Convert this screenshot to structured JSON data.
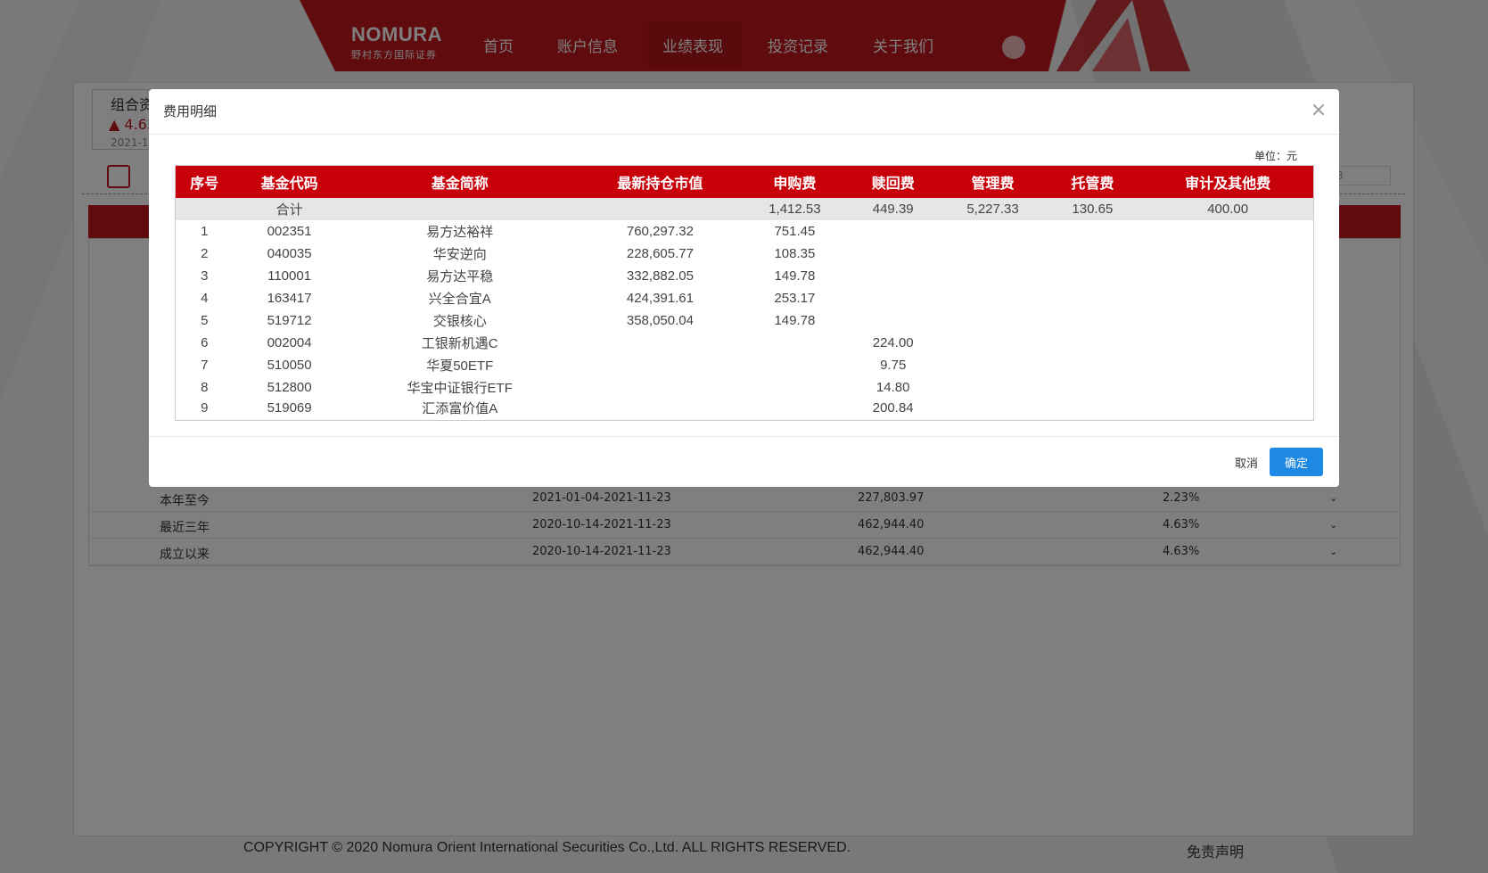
{
  "header": {
    "logo_main": "NOMURA",
    "logo_sub": "野村东方国际证券",
    "nav": [
      "首页",
      "账户信息",
      "业绩表现",
      "投资记录",
      "关于我们"
    ],
    "active_nav": "业绩表现"
  },
  "summary": {
    "title": "组合资",
    "value": "▲ 4.63",
    "date": "2021-1"
  },
  "bg_table_rows": [
    {
      "period": "本年至今",
      "range": "2021-01-04-2021-11-23",
      "amount": "227,803.97",
      "pct": "2.23%"
    },
    {
      "period": "最近三年",
      "range": "2020-10-14-2021-11-23",
      "amount": "462,944.40",
      "pct": "4.63%"
    },
    {
      "period": "成立以来",
      "range": "2020-10-14-2021-11-23",
      "amount": "462,944.40",
      "pct": "4.63%"
    }
  ],
  "footer": {
    "copyright": "COPYRIGHT © 2020 Nomura Orient International Securities Co.,Ltd. ALL RIGHTS RESERVED.",
    "disclaimer": "免责声明"
  },
  "modal": {
    "title": "费用明细",
    "close": "×",
    "unit": "单位：元",
    "columns": [
      "序号",
      "基金代码",
      "基金简称",
      "最新持仓市值",
      "申购费",
      "赎回费",
      "管理费",
      "托管费",
      "审计及其他费"
    ],
    "total": {
      "label": "合计",
      "purchase": "1,412.53",
      "redeem": "449.39",
      "management": "5,227.33",
      "custody": "130.65",
      "other": "400.00"
    },
    "rows": [
      {
        "no": "1",
        "code": "002351",
        "name": "易方达裕祥",
        "value": "760,297.32",
        "purchase": "751.45",
        "redeem": ""
      },
      {
        "no": "2",
        "code": "040035",
        "name": "华安逆向",
        "value": "228,605.77",
        "purchase": "108.35",
        "redeem": ""
      },
      {
        "no": "3",
        "code": "110001",
        "name": "易方达平稳",
        "value": "332,882.05",
        "purchase": "149.78",
        "redeem": ""
      },
      {
        "no": "4",
        "code": "163417",
        "name": "兴全合宜A",
        "value": "424,391.61",
        "purchase": "253.17",
        "redeem": ""
      },
      {
        "no": "5",
        "code": "519712",
        "name": "交银核心",
        "value": "358,050.04",
        "purchase": "149.78",
        "redeem": ""
      },
      {
        "no": "6",
        "code": "002004",
        "name": "工银新机遇C",
        "value": "",
        "purchase": "",
        "redeem": "224.00"
      },
      {
        "no": "7",
        "code": "510050",
        "name": "华夏50ETF",
        "value": "",
        "purchase": "",
        "redeem": "9.75"
      },
      {
        "no": "8",
        "code": "512800",
        "name": "华宝中证银行ETF",
        "value": "",
        "purchase": "",
        "redeem": "14.80"
      },
      {
        "no": "9",
        "code": "519069",
        "name": "汇添富价值A",
        "value": "",
        "purchase": "",
        "redeem": "200.84"
      }
    ],
    "cancel_label": "取消",
    "ok_label": "确定"
  }
}
